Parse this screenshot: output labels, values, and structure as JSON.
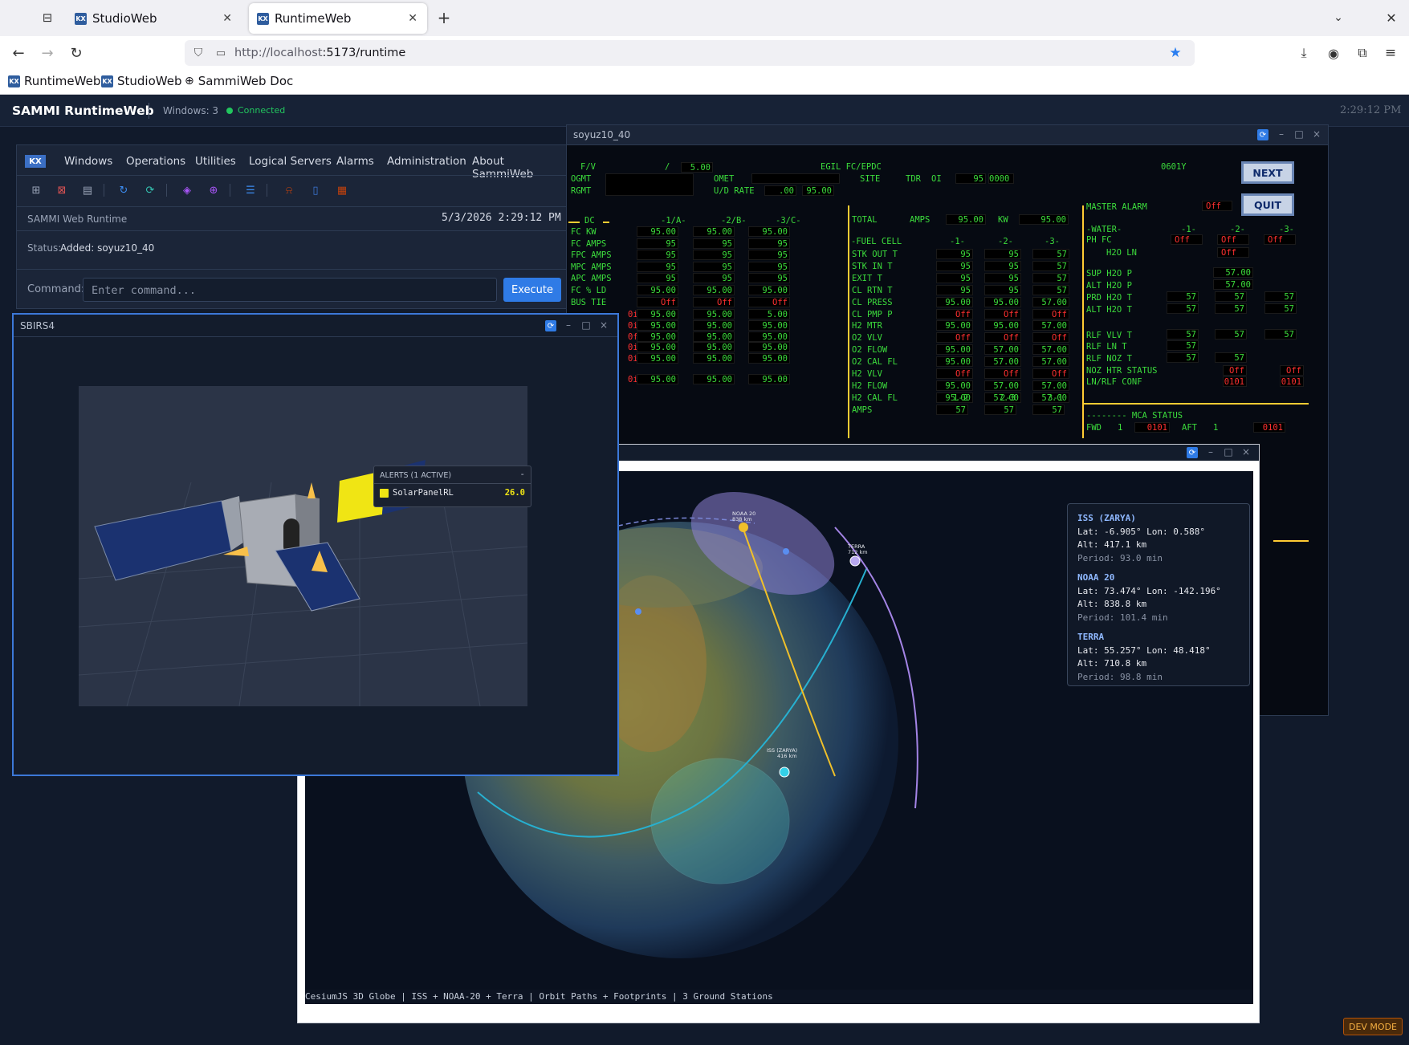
{
  "browser": {
    "tabs": [
      {
        "label": "StudioWeb",
        "active": false
      },
      {
        "label": "RuntimeWeb",
        "active": true
      }
    ],
    "url_host": "http://localhost",
    "url_path": ":5173/runtime",
    "bookmarks": [
      "RuntimeWeb",
      "StudioWeb",
      "SammiWeb Doc"
    ]
  },
  "app": {
    "title": "SAMMI RuntimeWeb",
    "windows": "Windows: 3",
    "status": "Connected",
    "clock": "2:29:12 PM",
    "dev_mode": "DEV MODE"
  },
  "runtime": {
    "logo": "KX",
    "menu": [
      "Windows",
      "Operations",
      "Utilities",
      "Logical Servers",
      "Alarms",
      "Administration",
      "About SammiWeb"
    ],
    "subtitle": "SAMMI Web Runtime",
    "datetime": "5/3/2026 2:29:12 PM",
    "status_label": "Status:",
    "status_value": "Added: soyuz10_40",
    "command_label": "Command:",
    "command_placeholder": "Enter command...",
    "execute_label": "Execute"
  },
  "soyuz": {
    "title": "soyuz10_40",
    "header": {
      "fv": "F/V",
      "slash": "/",
      "fv_val": "5.00",
      "egil": "EGIL FC/EPDC",
      "code": "0601Y",
      "ogmt": "OGMT",
      "rgmt": "RGMT",
      "omet": "OMET",
      "ud_rate": "U/D RATE",
      "ud_val1": ".00",
      "ud_val2": "95.00",
      "site": "SITE",
      "tdr": "TDR",
      "oi": "OI",
      "tdr_val": "95",
      "tdr_val2": "0000"
    },
    "next_label": "NEXT",
    "quit_label": "QUIT",
    "dc": {
      "title": "DC",
      "cols": [
        "-1/A-",
        "-2/B-",
        "-3/C-"
      ],
      "rows": [
        {
          "label": "FC KW",
          "v": [
            "95.00",
            "95.00",
            "95.00"
          ]
        },
        {
          "label": "FC AMPS",
          "v": [
            "95",
            "95",
            "95"
          ]
        },
        {
          "label": "FPC AMPS",
          "v": [
            "95",
            "95",
            "95"
          ]
        },
        {
          "label": "MPC AMPS",
          "v": [
            "95",
            "95",
            "95"
          ]
        },
        {
          "label": "APC AMPS",
          "v": [
            "95",
            "95",
            "95"
          ]
        },
        {
          "label": "FC % LD",
          "v": [
            "95.00",
            "95.00",
            "95.00"
          ]
        },
        {
          "label": "BUS TIE",
          "v": [
            "Off",
            "Off",
            "Off"
          ]
        }
      ],
      "extra_rows": [
        [
          "95.00",
          "95.00",
          "5.00"
        ],
        [
          "95.00",
          "95.00",
          "95.00"
        ],
        [
          "95.00",
          "95.00",
          "95.00"
        ],
        [
          "95.00",
          "95.00",
          "95.00"
        ],
        [
          "95.00",
          "95.00",
          "95.00"
        ],
        [
          "95.00",
          "95.00",
          "95.00"
        ],
        [
          "95.00",
          "95.00",
          "95.00"
        ]
      ],
      "extra_red": [
        "0i",
        "0i",
        "0f",
        "0i",
        "0i",
        "0i",
        "0i"
      ]
    },
    "fuelcell": {
      "total": "TOTAL",
      "amps": "AMPS",
      "amps_val": "95.00",
      "kw": "KW",
      "kw_val": "95.00",
      "title": "-FUEL CELL",
      "cols": [
        "-1-",
        "-2-",
        "-3-"
      ],
      "rows": [
        {
          "label": "STK OUT T",
          "v": [
            "95",
            "95",
            "57"
          ]
        },
        {
          "label": "STK IN T",
          "v": [
            "95",
            "95",
            "57"
          ]
        },
        {
          "label": "EXIT T",
          "v": [
            "95",
            "95",
            "57"
          ]
        },
        {
          "label": "CL RTN T",
          "v": [
            "95",
            "95",
            "57"
          ]
        },
        {
          "label": "CL PRESS",
          "v": [
            "95.00",
            "95.00",
            "57.00"
          ]
        },
        {
          "label": "CL PMP P",
          "v": [
            "Off",
            "Off",
            "Off"
          ]
        },
        {
          "label": "H2 MTR",
          "v": [
            "95.00",
            "95.00",
            "57.00"
          ]
        },
        {
          "label": "O2 VLV",
          "v": [
            "Off",
            "Off",
            "Off"
          ]
        },
        {
          "label": "O2 FLOW",
          "v": [
            "95.00",
            "57.00",
            "57.00"
          ]
        },
        {
          "label": "O2 CAL FL",
          "v": [
            "95.00",
            "57.00",
            "57.00"
          ]
        },
        {
          "label": "H2 VLV",
          "v": [
            "Off",
            "Off",
            "Off"
          ]
        },
        {
          "label": "H2 FLOW",
          "v": [
            "95.00",
            "57.00",
            "57.00"
          ]
        },
        {
          "label": "H2 CAL FL",
          "v": [
            "95.00",
            "57.00",
            "57.00"
          ]
        }
      ],
      "pair_cols": [
        "1-2",
        "2-3",
        "3-1"
      ],
      "pair_label": "AMPS",
      "pair_vals": [
        "57",
        "57",
        "57"
      ]
    },
    "water": {
      "master": "MASTER ALARM",
      "master_val": "Off",
      "title": "-WATER-",
      "cols": [
        "-1-",
        "-2-",
        "-3-"
      ],
      "ph_label": "PH FC",
      "ph": [
        "Off",
        "Off",
        "Off"
      ],
      "h2o_ln": "H2O LN",
      "h2o_ln_val": "Off",
      "sup": "SUP H2O P",
      "sup_val": "57.00",
      "alt": "ALT H2O P",
      "alt_val": "57.00",
      "prd": "PRD H2O T",
      "prd_v": [
        "57",
        "57",
        "57"
      ],
      "altt": "ALT H2O T",
      "altt_v": [
        "57",
        "57",
        "57"
      ],
      "rlfv": "RLF VLV T",
      "rlfv_v": [
        "57",
        "57",
        "57"
      ],
      "rlfl": "RLF LN T",
      "rlfl_v": "57",
      "rlfn": "RLF NOZ T",
      "rlfn_v": [
        "57",
        "57"
      ],
      "noz": "NOZ HTR STATUS",
      "noz_v": [
        "Off",
        "Off"
      ],
      "ln": "LN/RLF CONF",
      "ln_v": [
        "0101",
        "0101"
      ],
      "mca": "-------- MCA STATUS",
      "fwd": "FWD",
      "fwd_n": "1",
      "aft": "AFT",
      "aft_n": "1"
    }
  },
  "globe": {
    "caption": "CesiumJS 3D Globe | ISS + NOAA-20 + Terra | Orbit Paths + Footprints | 3 Ground Stations",
    "sats": [
      {
        "name": "ISS (ZARYA)",
        "pos": "Lat: -6.905° Lon: 0.588°",
        "alt": "Alt: 417.1 km",
        "period": "Period: 93.0 min"
      },
      {
        "name": "NOAA 20",
        "pos": "Lat: 73.474° Lon: -142.196°",
        "alt": "Alt: 838.8 km",
        "period": "Period: 101.4 min"
      },
      {
        "name": "TERRA",
        "pos": "Lat: 55.257° Lon: 48.418°",
        "alt": "Alt: 710.8 km",
        "period": "Period: 98.8 min"
      }
    ],
    "labels": {
      "noaa": "NOAA 20",
      "noaa_alt": "838 km",
      "terra": "TERRA",
      "terra_alt": "712 km",
      "iss": "ISS (ZARYA)",
      "iss_alt": "416 km"
    }
  },
  "sbirs": {
    "title": "SBIRS4",
    "alerts_title": "ALERTS (1 ACTIVE)",
    "alerts_toggle": "-",
    "alert_name": "SolarPanelRL",
    "alert_value": "26.0",
    "colors": {
      "panel": "#1b3270",
      "alert": "#f0e514",
      "accent": "#3c78d8"
    }
  }
}
